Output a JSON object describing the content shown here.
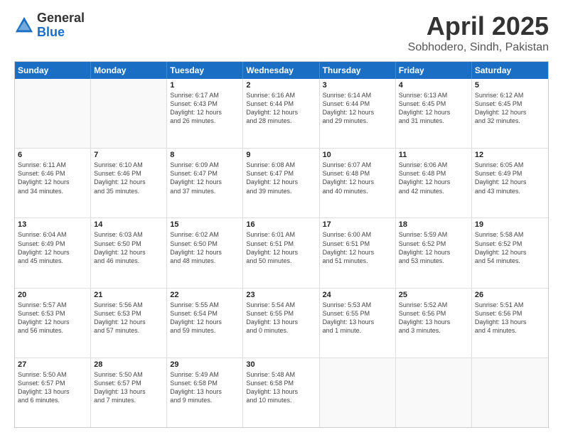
{
  "header": {
    "logo": {
      "general": "General",
      "blue": "Blue"
    },
    "title": "April 2025",
    "location": "Sobhodero, Sindh, Pakistan"
  },
  "calendar": {
    "days": [
      "Sunday",
      "Monday",
      "Tuesday",
      "Wednesday",
      "Thursday",
      "Friday",
      "Saturday"
    ],
    "weeks": [
      [
        {
          "day": "",
          "content": ""
        },
        {
          "day": "",
          "content": ""
        },
        {
          "day": "1",
          "content": "Sunrise: 6:17 AM\nSunset: 6:43 PM\nDaylight: 12 hours\nand 26 minutes."
        },
        {
          "day": "2",
          "content": "Sunrise: 6:16 AM\nSunset: 6:44 PM\nDaylight: 12 hours\nand 28 minutes."
        },
        {
          "day": "3",
          "content": "Sunrise: 6:14 AM\nSunset: 6:44 PM\nDaylight: 12 hours\nand 29 minutes."
        },
        {
          "day": "4",
          "content": "Sunrise: 6:13 AM\nSunset: 6:45 PM\nDaylight: 12 hours\nand 31 minutes."
        },
        {
          "day": "5",
          "content": "Sunrise: 6:12 AM\nSunset: 6:45 PM\nDaylight: 12 hours\nand 32 minutes."
        }
      ],
      [
        {
          "day": "6",
          "content": "Sunrise: 6:11 AM\nSunset: 6:46 PM\nDaylight: 12 hours\nand 34 minutes."
        },
        {
          "day": "7",
          "content": "Sunrise: 6:10 AM\nSunset: 6:46 PM\nDaylight: 12 hours\nand 35 minutes."
        },
        {
          "day": "8",
          "content": "Sunrise: 6:09 AM\nSunset: 6:47 PM\nDaylight: 12 hours\nand 37 minutes."
        },
        {
          "day": "9",
          "content": "Sunrise: 6:08 AM\nSunset: 6:47 PM\nDaylight: 12 hours\nand 39 minutes."
        },
        {
          "day": "10",
          "content": "Sunrise: 6:07 AM\nSunset: 6:48 PM\nDaylight: 12 hours\nand 40 minutes."
        },
        {
          "day": "11",
          "content": "Sunrise: 6:06 AM\nSunset: 6:48 PM\nDaylight: 12 hours\nand 42 minutes."
        },
        {
          "day": "12",
          "content": "Sunrise: 6:05 AM\nSunset: 6:49 PM\nDaylight: 12 hours\nand 43 minutes."
        }
      ],
      [
        {
          "day": "13",
          "content": "Sunrise: 6:04 AM\nSunset: 6:49 PM\nDaylight: 12 hours\nand 45 minutes."
        },
        {
          "day": "14",
          "content": "Sunrise: 6:03 AM\nSunset: 6:50 PM\nDaylight: 12 hours\nand 46 minutes."
        },
        {
          "day": "15",
          "content": "Sunrise: 6:02 AM\nSunset: 6:50 PM\nDaylight: 12 hours\nand 48 minutes."
        },
        {
          "day": "16",
          "content": "Sunrise: 6:01 AM\nSunset: 6:51 PM\nDaylight: 12 hours\nand 50 minutes."
        },
        {
          "day": "17",
          "content": "Sunrise: 6:00 AM\nSunset: 6:51 PM\nDaylight: 12 hours\nand 51 minutes."
        },
        {
          "day": "18",
          "content": "Sunrise: 5:59 AM\nSunset: 6:52 PM\nDaylight: 12 hours\nand 53 minutes."
        },
        {
          "day": "19",
          "content": "Sunrise: 5:58 AM\nSunset: 6:52 PM\nDaylight: 12 hours\nand 54 minutes."
        }
      ],
      [
        {
          "day": "20",
          "content": "Sunrise: 5:57 AM\nSunset: 6:53 PM\nDaylight: 12 hours\nand 56 minutes."
        },
        {
          "day": "21",
          "content": "Sunrise: 5:56 AM\nSunset: 6:53 PM\nDaylight: 12 hours\nand 57 minutes."
        },
        {
          "day": "22",
          "content": "Sunrise: 5:55 AM\nSunset: 6:54 PM\nDaylight: 12 hours\nand 59 minutes."
        },
        {
          "day": "23",
          "content": "Sunrise: 5:54 AM\nSunset: 6:55 PM\nDaylight: 13 hours\nand 0 minutes."
        },
        {
          "day": "24",
          "content": "Sunrise: 5:53 AM\nSunset: 6:55 PM\nDaylight: 13 hours\nand 1 minute."
        },
        {
          "day": "25",
          "content": "Sunrise: 5:52 AM\nSunset: 6:56 PM\nDaylight: 13 hours\nand 3 minutes."
        },
        {
          "day": "26",
          "content": "Sunrise: 5:51 AM\nSunset: 6:56 PM\nDaylight: 13 hours\nand 4 minutes."
        }
      ],
      [
        {
          "day": "27",
          "content": "Sunrise: 5:50 AM\nSunset: 6:57 PM\nDaylight: 13 hours\nand 6 minutes."
        },
        {
          "day": "28",
          "content": "Sunrise: 5:50 AM\nSunset: 6:57 PM\nDaylight: 13 hours\nand 7 minutes."
        },
        {
          "day": "29",
          "content": "Sunrise: 5:49 AM\nSunset: 6:58 PM\nDaylight: 13 hours\nand 9 minutes."
        },
        {
          "day": "30",
          "content": "Sunrise: 5:48 AM\nSunset: 6:58 PM\nDaylight: 13 hours\nand 10 minutes."
        },
        {
          "day": "",
          "content": ""
        },
        {
          "day": "",
          "content": ""
        },
        {
          "day": "",
          "content": ""
        }
      ]
    ]
  }
}
